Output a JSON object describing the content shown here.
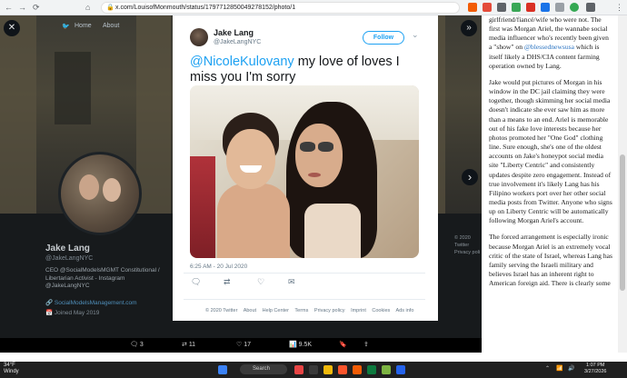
{
  "browser": {
    "url": "x.com/LouisofMonmouth/status/1797712850049278152/photo/1",
    "nav_back": "←",
    "nav_forward": "→",
    "nav_reload": "⟳",
    "nav_home": "⌂",
    "menu": "⋮"
  },
  "backdrop": {
    "nav_home": "Home",
    "nav_about": "About",
    "profile_name": "Jake Lang",
    "profile_handle": "@JakeLangNYC",
    "bio_line1": "CEO @SocialModelsMGMT Constitutional /",
    "bio_line2": "Libertarian Activist - Instagram",
    "bio_line3": "@JakeLangNYC",
    "link": "SocialModelsManagement.com",
    "joined": "Joined May 2019",
    "right_footer_line1": "© 2020 Twitter",
    "right_footer_line2": "Privacy poli"
  },
  "modal": {
    "close_button": "✕",
    "next_button": "»",
    "next_arrow": "›",
    "author_name": "Jake Lang",
    "author_handle": "@JakeLangNYC",
    "follow_label": "Follow",
    "chevron": "⌄",
    "mention": "@NicoleKulovany",
    "tweet_text": " my love of loves I miss you I'm sorry",
    "timestamp": "6:25 AM - 20 Jul 2020",
    "footer_links": [
      "© 2020 Twitter",
      "About",
      "Help Center",
      "Terms",
      "Privacy policy",
      "Imprint",
      "Cookies",
      "Ads info"
    ]
  },
  "action_bar": {
    "replies": "3",
    "retweets": "11",
    "likes": "17",
    "views": "9.5K"
  },
  "article": {
    "p1_a": "girlfriend/fiancé/wife who were not. The first was Morgan Ariel, the wannabe social media influencer who's recently been given a \"show\" on ",
    "p1_link": "@blessednewsusa",
    "p1_b": " which is itself likely a DHS/CIA content farming operation owned by Lang.",
    "p2_a": "Jake would put pictures of Morgan in his window in the DC jail claiming they were together, though skimming her social media doesn't indicate she ever saw him as more than a means to an end. Ariel is memorable out of his fake love interests because her photos promoted her \"One God\" clothing line. Sure enough, she's one of the oldest accounts on Jake's honeypot social media site \"Liberty Centric\" and consistently updates despite zero engagement. Instead of true involvement it's likely Lang has his Filipino workers port over her other social media posts from Twitter. Anyone who signs up on Liberty Centric will be automatically following Morgan Ariel's account.",
    "p3_a": "The forced arrangement is especially ironic because Morgan Ariel is an extremely vocal critic of the state of Israel, whereas Lang has family serving the Israeli military and believes Israel has an inherent right to American foreign aid. There is clearly some"
  },
  "taskbar": {
    "temp": "34°F",
    "condition": "Windy",
    "search_placeholder": "Search",
    "time": "1:07 PM",
    "date": "3/27/2026"
  }
}
